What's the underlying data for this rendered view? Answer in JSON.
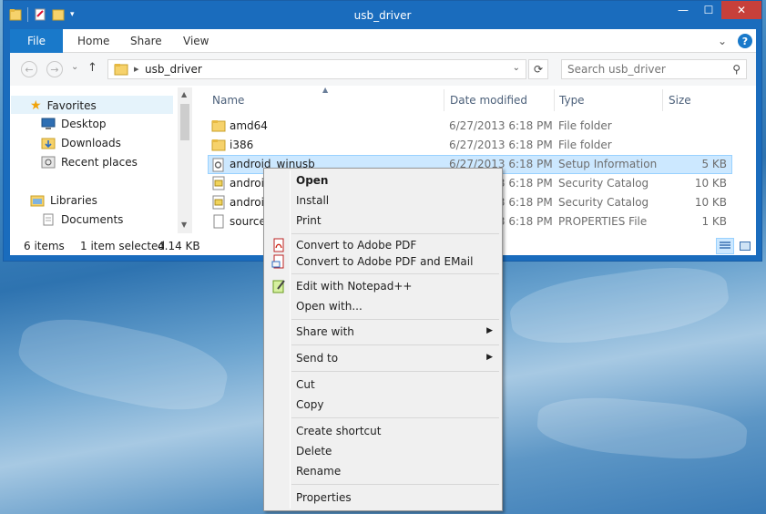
{
  "window": {
    "title": "usb_driver",
    "controls": {
      "minimize": "—",
      "maximize": "☐",
      "close": "✕"
    }
  },
  "ribbon": {
    "tabs": [
      "File",
      "Home",
      "Share",
      "View"
    ],
    "expand_icon": "⌄",
    "help": "?"
  },
  "address": {
    "back": "←",
    "forward": "→",
    "recent": "⌄",
    "up": "↑",
    "separator": "▸",
    "path": "usb_driver",
    "dropdown": "⌄",
    "refresh": "⟳"
  },
  "search": {
    "placeholder": "Search usb_driver",
    "icon": "⚲"
  },
  "nav": {
    "favorites": "Favorites",
    "items": [
      "Desktop",
      "Downloads",
      "Recent places"
    ],
    "libraries": "Libraries",
    "library_items": [
      "Documents"
    ]
  },
  "columns": {
    "name": "Name",
    "date": "Date modified",
    "type": "Type",
    "size": "Size"
  },
  "files": [
    {
      "name": "amd64",
      "date": "6/27/2013 6:18 PM",
      "type": "File folder",
      "size": ""
    },
    {
      "name": "i386",
      "date": "6/27/2013 6:18 PM",
      "type": "File folder",
      "size": ""
    },
    {
      "name": "android_winusb",
      "date": "6/27/2013 6:18 PM",
      "type": "Setup Information",
      "size": "5 KB"
    },
    {
      "name": "androidwinusb86",
      "date": "6/27/2013 6:18 PM",
      "type": "Security Catalog",
      "size": "10 KB"
    },
    {
      "name": "androidwinusba64",
      "date": "6/27/2013 6:18 PM",
      "type": "Security Catalog",
      "size": "10 KB"
    },
    {
      "name": "source.properties",
      "date": "6/27/2013 6:18 PM",
      "type": "PROPERTIES File",
      "size": "1 KB"
    }
  ],
  "status": {
    "count": "6 items",
    "selected": "1 item selected",
    "selected_size": "4.14 KB"
  },
  "context_menu": {
    "open": "Open",
    "install": "Install",
    "print": "Print",
    "convert_pdf": "Convert to Adobe PDF",
    "convert_pdf_email": "Convert to Adobe PDF and EMail",
    "edit_notepad": "Edit with Notepad++",
    "open_with": "Open with...",
    "share_with": "Share with",
    "send_to": "Send to",
    "cut": "Cut",
    "copy": "Copy",
    "create_shortcut": "Create shortcut",
    "delete": "Delete",
    "rename": "Rename",
    "properties": "Properties",
    "submenu_arrow": "▶"
  },
  "colors": {
    "title_bar": "#1a6cbd",
    "file_tab": "#1979ca",
    "close_button": "#c7403a",
    "selection": "#cce8ff",
    "selection_border": "#99d1ff"
  }
}
